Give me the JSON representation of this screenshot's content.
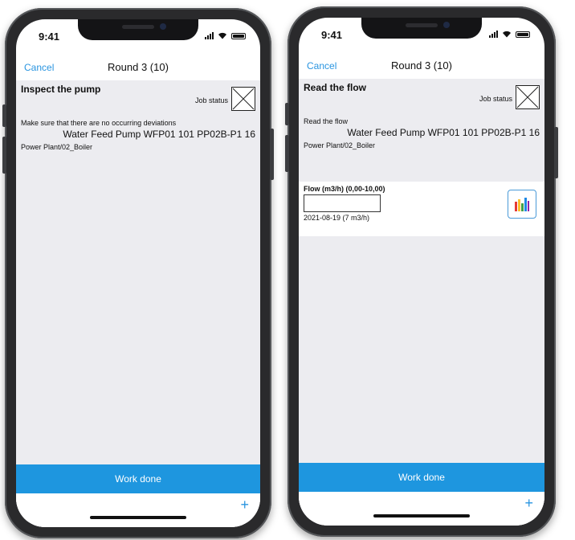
{
  "status": {
    "time": "9:41"
  },
  "screen1": {
    "nav": {
      "cancel": "Cancel",
      "title": "Round 3 (10)"
    },
    "task": {
      "title": "Inspect the pump",
      "job_status_label": "Job status",
      "description": "Make sure that there are no occurring deviations",
      "equipment": "Water Feed Pump WFP01 101 PP02B-P1 16",
      "location": "Power Plant/02_Boiler"
    },
    "work_done_label": "Work done",
    "add_label": "+"
  },
  "screen2": {
    "nav": {
      "cancel": "Cancel",
      "title": "Round 3 (10)"
    },
    "task": {
      "title": "Read the flow",
      "job_status_label": "Job status",
      "description": "Read the flow",
      "equipment": "Water Feed Pump WFP01 101 PP02B-P1 16",
      "location": "Power Plant/02_Boiler"
    },
    "flow": {
      "label": "Flow (m3/h) (0,00-10,00)",
      "input_value": "",
      "history": "2021-08-19 (7 m3/h)"
    },
    "work_done_label": "Work done",
    "add_label": "+"
  },
  "colors": {
    "accent": "#1e96df",
    "link": "#2a95e0",
    "background": "#ececf0"
  }
}
